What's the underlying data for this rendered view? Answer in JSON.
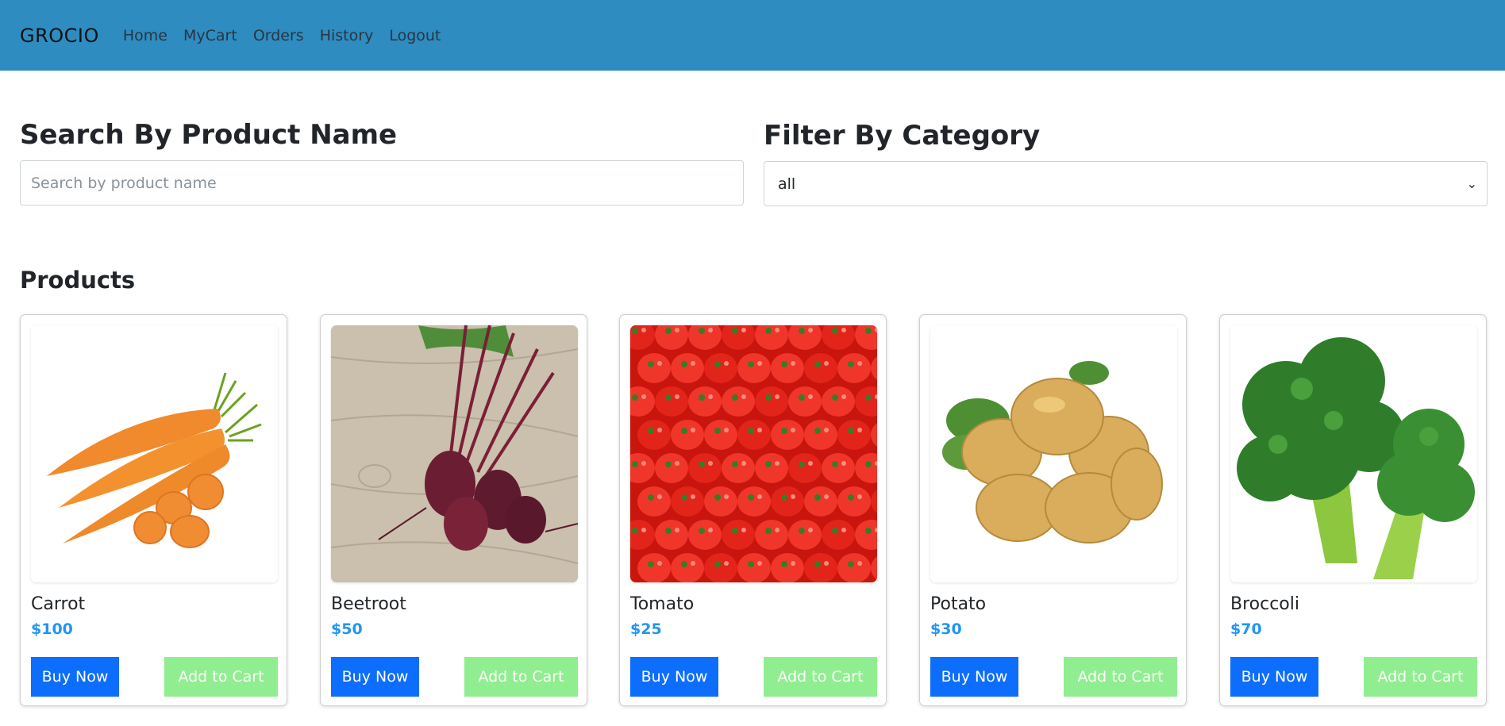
{
  "nav": {
    "brand": "GROCIO",
    "links": [
      "Home",
      "MyCart",
      "Orders",
      "History",
      "Logout"
    ]
  },
  "search": {
    "title": "Search By Product Name",
    "placeholder": "Search by product name",
    "value": ""
  },
  "filter": {
    "title": "Filter By Category",
    "selected": "all"
  },
  "products": {
    "title": "Products",
    "items": [
      {
        "name": "Carrot",
        "price": "$100",
        "image": "carrot-image"
      },
      {
        "name": "Beetroot",
        "price": "$50",
        "image": "beetroot-image"
      },
      {
        "name": "Tomato",
        "price": "$25",
        "image": "tomato-image"
      },
      {
        "name": "Potato",
        "price": "$30",
        "image": "potato-image"
      },
      {
        "name": "Broccoli",
        "price": "$70",
        "image": "broccoli-image"
      }
    ],
    "buy_label": "Buy Now",
    "cart_label": "Add to Cart"
  },
  "colors": {
    "navbar": "#2e8cc1",
    "price": "#2196f3",
    "buy_button": "#0d6efd",
    "cart_button": "#90ee90"
  }
}
